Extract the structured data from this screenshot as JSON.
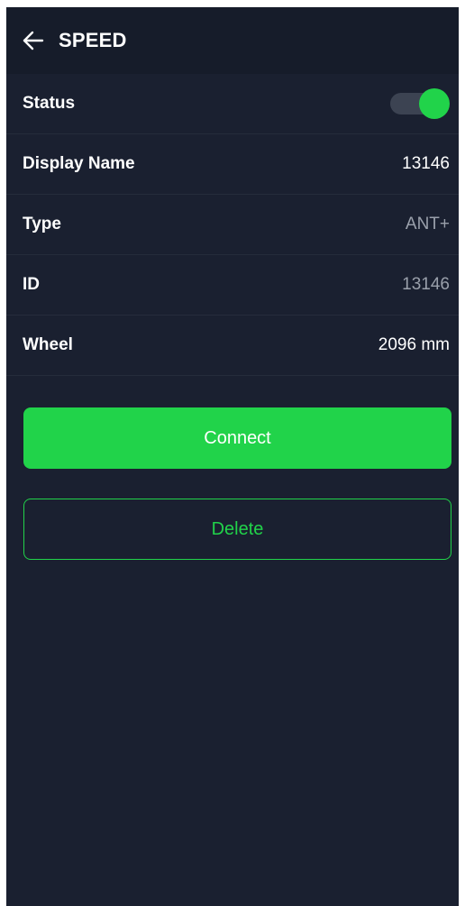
{
  "header": {
    "back_icon": "arrow-left-icon",
    "title": "SPEED"
  },
  "settings": {
    "status": {
      "label": "Status",
      "enabled": true
    },
    "display_name": {
      "label": "Display Name",
      "value": "13146"
    },
    "type": {
      "label": "Type",
      "value": "ANT+"
    },
    "id": {
      "label": "ID",
      "value": "13146"
    },
    "wheel": {
      "label": "Wheel",
      "value": "2096 mm"
    }
  },
  "actions": {
    "connect_label": "Connect",
    "delete_label": "Delete"
  },
  "colors": {
    "background": "#1a2030",
    "header_background": "#161c2a",
    "accent": "#21d34a",
    "text_primary": "#ffffff",
    "text_muted": "#9aa0ab"
  }
}
